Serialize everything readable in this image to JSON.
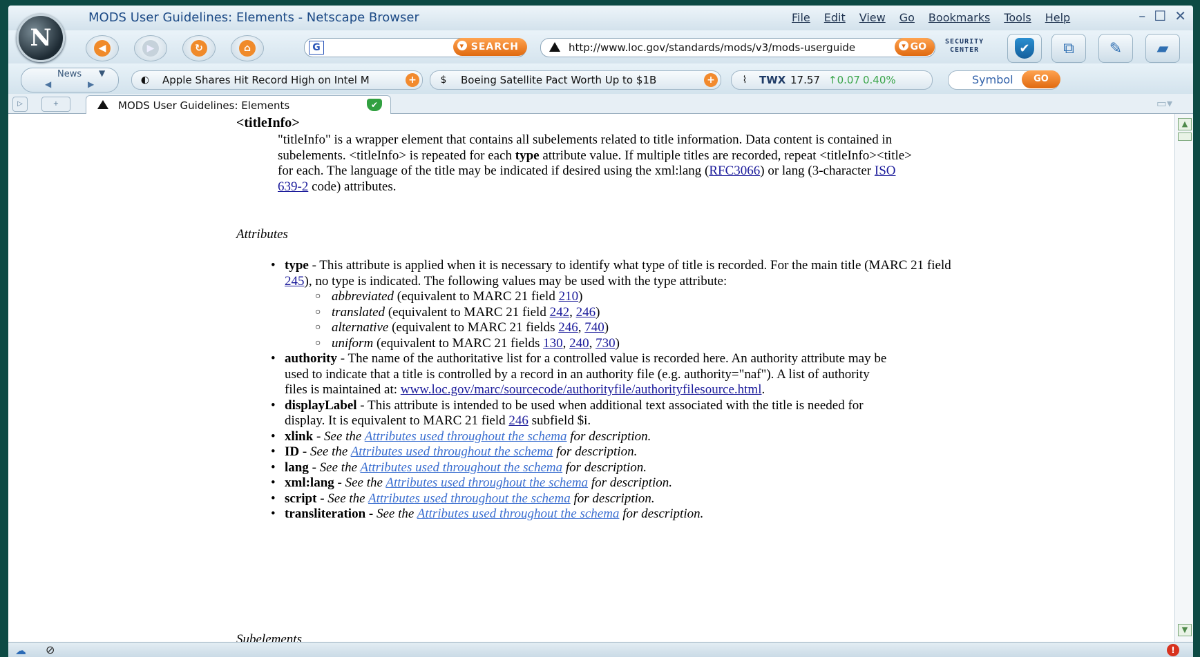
{
  "window": {
    "title": "MODS User Guidelines: Elements - Netscape Browser",
    "logo": "N",
    "controls": [
      "–",
      "☐",
      "✕"
    ]
  },
  "menu": [
    "File",
    "Edit",
    "View",
    "Go",
    "Bookmarks",
    "Tools",
    "Help"
  ],
  "toolbar": {
    "search_button": "SEARCH",
    "search_value": "",
    "url": "http://www.loc.gov/standards/mods/v3/mods-userguide",
    "go_button": "GO",
    "security_center": [
      "SECURITY",
      "CENTER"
    ]
  },
  "sidebar_bar": {
    "news_label": "News",
    "headlines": [
      "Apple Shares Hit Record High on Intel M",
      "Boeing Satellite Pact Worth Up to $1B"
    ],
    "stock": {
      "symbol": "TWX",
      "price": "17.57",
      "change": "↑0.07",
      "pct": "0.40%"
    },
    "symbol_label": "Symbol",
    "symbol_go": "GO"
  },
  "tab": {
    "title": "MODS User Guidelines: Elements"
  },
  "doc": {
    "element_heading": "<titleInfo>",
    "intro_1": "\"titleInfo\" is a wrapper element that contains all subelements related to title information. Data content is contained in subelements. <titleInfo> is repeated for each ",
    "intro_bold": "type",
    "intro_2": " attribute value. If multiple titles are recorded, repeat <titleInfo><title> for each. The language of the title may be indicated if desired using the xml:lang (",
    "rfc_link": "RFC3066",
    "intro_3": ") or lang (3-character ",
    "iso_link": "ISO 639-2",
    "intro_4": " code) attributes.",
    "attributes_heading": "Attributes",
    "subelements_heading": "Subelements",
    "type": {
      "name": "type",
      "text_1": " - This attribute is applied when it is necessary to identify what type of title is recorded. For the main title (MARC 21 field ",
      "link": "245",
      "text_2": "), no type is indicated. The following values may be used with the type attribute:",
      "values": [
        {
          "term": "abbreviated",
          "pre": " (equivalent to MARC 21 field ",
          "links": [
            "210"
          ],
          "post": ")"
        },
        {
          "term": "translated",
          "pre": " (equivalent to MARC 21 field ",
          "links": [
            "242",
            "246"
          ],
          "post": ")"
        },
        {
          "term": "alternative",
          "pre": " (equivalent to MARC 21 fields ",
          "links": [
            "246",
            "740"
          ],
          "post": ")"
        },
        {
          "term": "uniform",
          "pre": " (equivalent to MARC 21 fields ",
          "links": [
            "130",
            "240",
            "730"
          ],
          "post": ")"
        }
      ]
    },
    "authority": {
      "name": "authority",
      "text": " - The name of the authoritative list for a controlled value is recorded here. An authority attribute may be used to indicate that a title is controlled by a record in an authority file (e.g. authority=\"naf\"). A list of authority files is maintained at: ",
      "link": "www.loc.gov/marc/sourcecode/authorityfile/authorityfilesource.html",
      "end": "."
    },
    "displayLabel": {
      "name": "displayLabel",
      "text_1": " - This attribute is intended to be used when additional text associated with the title is needed for display. It is equivalent to MARC 21 field ",
      "link": "246",
      "text_2": " subfield $i."
    },
    "schema_attrs": [
      {
        "name": "xlink"
      },
      {
        "name": "ID"
      },
      {
        "name": "lang"
      },
      {
        "name": "xml:lang"
      },
      {
        "name": "script"
      },
      {
        "name": "transliteration"
      }
    ],
    "see_the": " - See the ",
    "schema_link": "Attributes used throughout the schema",
    "for_description": " for description."
  }
}
